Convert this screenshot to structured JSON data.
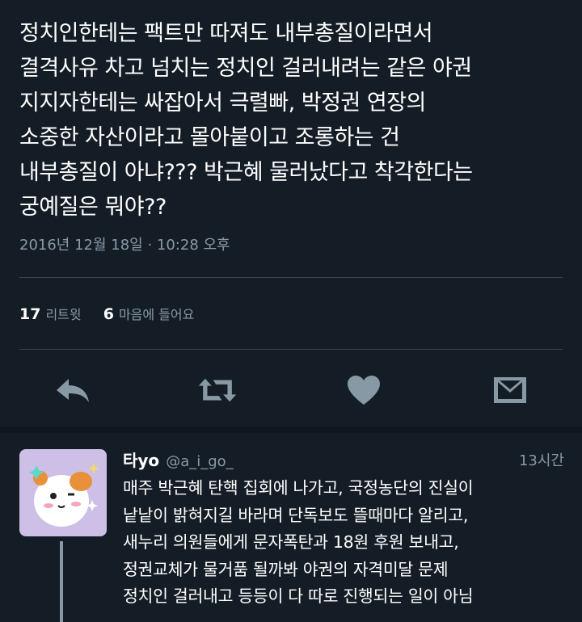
{
  "tweet": {
    "lines": [
      "정치인한테는 팩트만 따져도 내부총질이라면서",
      "결격사유 차고 넘치는 정치인 걸러내려는 같은 야권",
      "지지자한테는 싸잡아서 극렬빠, 박정권 연장의",
      "소중한 자산이라고 몰아붙이고 조롱하는 건",
      "내부총질이 아냐??? 박근혜 물러났다고 착각한다는",
      "궁예질은 뭐야??"
    ],
    "timestamp": "2016년 12월 18일 · 10:28 오후"
  },
  "stats": {
    "retweets_count": "17",
    "retweets_label": "리트윗",
    "likes_count": "6",
    "likes_label": "마음에 들어요"
  },
  "actions": {
    "reply_icon": "reply-icon",
    "retweet_icon": "retweet-icon",
    "like_icon": "heart-icon",
    "dm_icon": "envelope-icon"
  },
  "reply": {
    "name": "타yo",
    "handle": "@a_i_go_",
    "time": "13시간",
    "lines": [
      "매주 박근혜 탄핵 집회에 나가고, 국정농단의 진실이",
      "낱낱이 밝혀지길 바라며 단독보도 뜰때마다 알리고,",
      "새누리 의원들에게 문자폭탄과 18원 후원 보내고,",
      "정권교체가 물거품 될까봐 야권의 자격미달 문제",
      "정치인 걸러내고 등등이 다 따로 진행되는 일이 아님"
    ]
  },
  "colors": {
    "background": "#141d26",
    "secondary_text": "#8899a6",
    "divider": "#38444d"
  }
}
